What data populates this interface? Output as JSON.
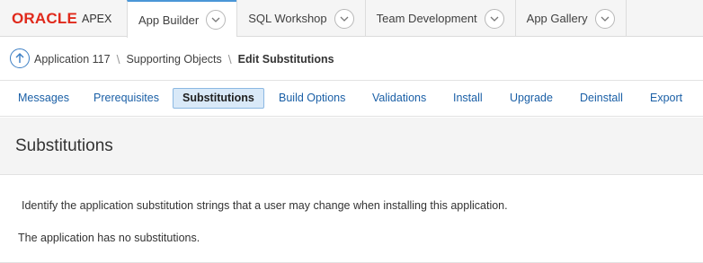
{
  "logo": {
    "oracle": "ORACLE",
    "apex": "APEX"
  },
  "topnav": {
    "tabs": [
      {
        "label": "App Builder",
        "active": true
      },
      {
        "label": "SQL Workshop",
        "active": false
      },
      {
        "label": "Team Development",
        "active": false
      },
      {
        "label": "App Gallery",
        "active": false
      }
    ]
  },
  "breadcrumb": {
    "items": [
      "Application 117",
      "Supporting Objects"
    ],
    "current": "Edit Substitutions",
    "separator": "\\"
  },
  "subtabs": [
    {
      "label": "Messages",
      "active": false
    },
    {
      "label": "Prerequisites",
      "active": false
    },
    {
      "label": "Substitutions",
      "active": true
    },
    {
      "label": "Build Options",
      "active": false
    },
    {
      "label": "Validations",
      "active": false
    },
    {
      "label": "Install",
      "active": false
    },
    {
      "label": "Upgrade",
      "active": false
    },
    {
      "label": "Deinstall",
      "active": false
    },
    {
      "label": "Export",
      "active": false
    }
  ],
  "region": {
    "title": "Substitutions",
    "description": "Identify the application substitution strings that a user may change when installing this application.",
    "no_data": "The application has no substitutions."
  },
  "colors": {
    "brand_red": "#e0291b",
    "link_blue": "#1a5fa6",
    "active_tab_accent": "#4a96d7",
    "active_subtab_bg": "#d9e9f8"
  }
}
